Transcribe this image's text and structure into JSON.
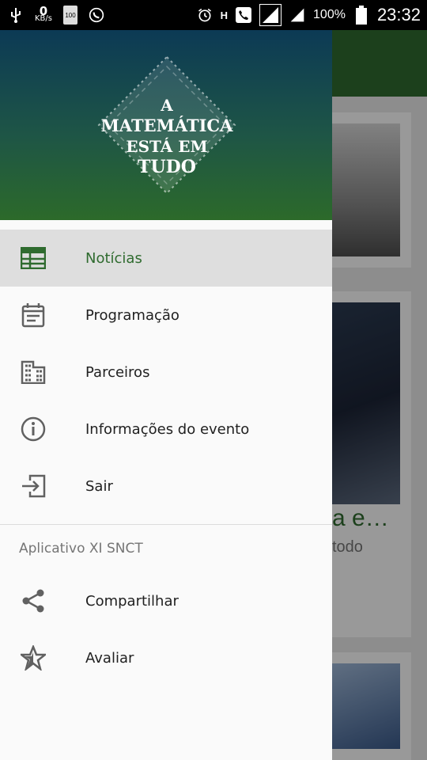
{
  "status_bar": {
    "net_speed_value": "0",
    "net_speed_unit": "KB/s",
    "storage_badge": "100",
    "network_type": "H",
    "battery_percent": "100%",
    "time": "23:32"
  },
  "drawer": {
    "logo_lines": [
      "A",
      "MATEMÁTICA",
      "ESTÁ EM",
      "TUDO"
    ],
    "accent_color": "#2f6b2f",
    "items": [
      {
        "label": "Notícias",
        "icon": "newspaper-icon",
        "active": true
      },
      {
        "label": "Programação",
        "icon": "calendar-icon",
        "active": false
      },
      {
        "label": "Parceiros",
        "icon": "building-icon",
        "active": false
      },
      {
        "label": "Informações do evento",
        "icon": "info-icon",
        "active": false
      },
      {
        "label": "Sair",
        "icon": "exit-icon",
        "active": false
      }
    ],
    "section_title": "Aplicativo XI SNCT",
    "section_items": [
      {
        "label": "Compartilhar",
        "icon": "share-icon"
      },
      {
        "label": "Avaliar",
        "icon": "star-icon"
      }
    ]
  },
  "background": {
    "card_title_fragment": "a e…",
    "card_subtitle_fragment": "todo"
  }
}
